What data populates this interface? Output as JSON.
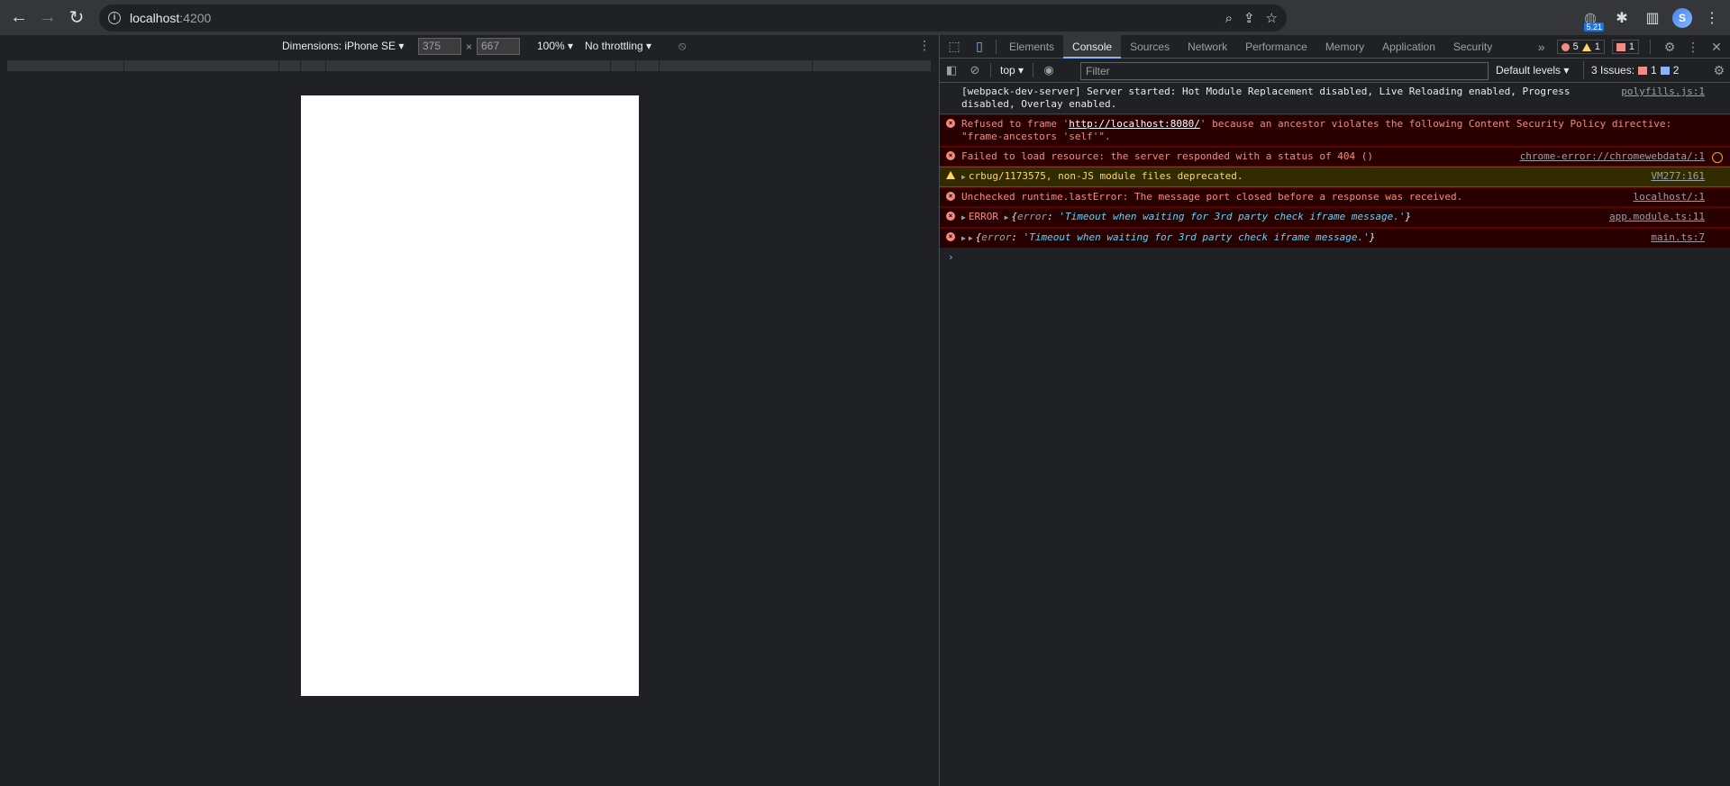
{
  "browser": {
    "back_icon": "arrow-left",
    "forward_icon": "arrow-right",
    "reload_icon": "reload",
    "url_host": "localhost",
    "url_port": ":4200",
    "extension_badge": "5.21"
  },
  "device_toolbar": {
    "dimensions_label": "Dimensions: iPhone SE",
    "width": "375",
    "height": "667",
    "times": "×",
    "zoom": "100%",
    "throttling": "No throttling"
  },
  "devtools": {
    "tabs": [
      "Elements",
      "Console",
      "Sources",
      "Network",
      "Performance",
      "Memory",
      "Application",
      "Security"
    ],
    "active_tab": "Console",
    "more_tabs": "»",
    "error_count": "5",
    "warning_count": "1",
    "issue_count": "1"
  },
  "console_toolbar": {
    "context": "top",
    "filter_placeholder": "Filter",
    "levels": "Default levels",
    "issues_label": "3 Issues:",
    "issues_red": "1",
    "issues_blue": "2"
  },
  "messages": [
    {
      "level": "info",
      "text": "[webpack-dev-server] Server started: Hot Module Replacement disabled, Live Reloading enabled, Progress disabled, Overlay enabled.",
      "source": "polyfills.js:1"
    },
    {
      "level": "error",
      "text_before": "Refused to frame '",
      "link": "http://localhost:8080/",
      "text_after": "' because an ancestor violates the following Content Security Policy directive: \"frame-ancestors 'self'\".",
      "source": ""
    },
    {
      "level": "error",
      "text": "Failed to load resource: the server responded with a status of 404 ()",
      "source": "chrome-error://chromewebdata/:1"
    },
    {
      "level": "warning",
      "text": "crbug/1173575, non-JS module files deprecated.",
      "source": "VM277:161"
    },
    {
      "level": "error",
      "text": "Unchecked runtime.lastError: The message port closed before a response was received.",
      "source": "localhost/:1"
    },
    {
      "level": "error",
      "prefix": "ERROR",
      "key": "error",
      "value": "'Timeout when waiting for 3rd party check iframe message.'",
      "source": "app.module.ts:11"
    },
    {
      "level": "error",
      "prefix": "",
      "key": "error",
      "value": "'Timeout when waiting for 3rd party check iframe message.'",
      "source": "main.ts:7"
    }
  ]
}
